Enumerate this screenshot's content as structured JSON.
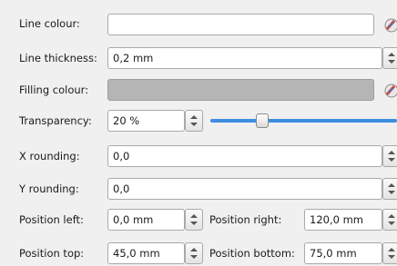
{
  "fields": {
    "line_colour": {
      "label": "Line colour:",
      "value": ""
    },
    "line_thickness": {
      "label": "Line thickness:",
      "value": "0,2 mm"
    },
    "filling_colour": {
      "label": "Filling colour:",
      "value": ""
    },
    "transparency": {
      "label": "Transparency:",
      "value": "20 %",
      "slider_fraction": 0.2
    },
    "x_rounding": {
      "label": "X rounding:",
      "value": "0,0"
    },
    "y_rounding": {
      "label": "Y rounding:",
      "value": "0,0"
    },
    "position_left": {
      "label": "Position left:",
      "value": "0,0 mm"
    },
    "position_right": {
      "label": "Position right:",
      "value": "120,0 mm"
    },
    "position_top": {
      "label": "Position top:",
      "value": "45,0 mm"
    },
    "position_bottom": {
      "label": "Position bottom:",
      "value": "75,0 mm"
    }
  },
  "colors": {
    "filling_swatch": "#b5b5b5",
    "slider_track": "#3d8ee0",
    "picker_accent_red": "#d64533",
    "picker_accent_blue": "#2f7fd6"
  },
  "icons": {
    "colour_picker": "colour-picker-icon",
    "spin": "spin-arrows-icon"
  }
}
